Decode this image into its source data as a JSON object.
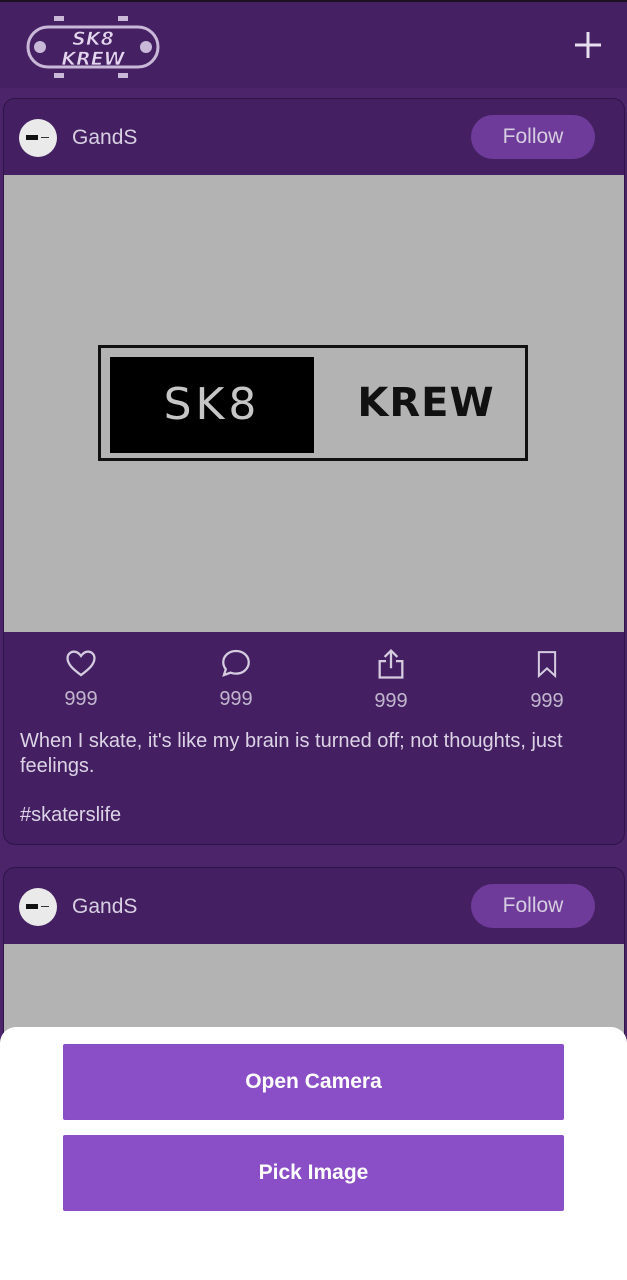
{
  "app": {
    "logo_line1": "SK8",
    "logo_line2": "KREW",
    "add_icon": "plus-icon"
  },
  "posts": [
    {
      "username": "GandS",
      "follow_label": "Follow",
      "image_text_left": "SK8",
      "image_text_right": "KREW",
      "likes": "999",
      "comments": "999",
      "shares": "999",
      "saves": "999",
      "caption": "When I skate, it's like my brain is turned off; not thoughts, just feelings.",
      "hashtag": "#skaterslife"
    },
    {
      "username": "GandS",
      "follow_label": "Follow"
    }
  ],
  "sheet": {
    "open_camera_label": "Open Camera",
    "pick_image_label": "Pick Image"
  },
  "colors": {
    "background": "#4b2469",
    "card": "#442062",
    "button_purple": "#8a4fc6",
    "follow_pill": "#6e3b9a"
  },
  "icons": [
    "heart-icon",
    "comment-icon",
    "share-icon",
    "bookmark-icon",
    "plus-icon"
  ]
}
